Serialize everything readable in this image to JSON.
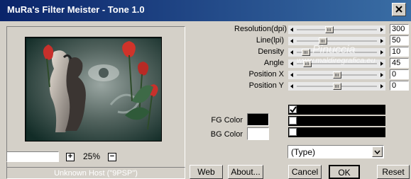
{
  "window": {
    "title": "MuRa's Filter Meister - Tone 1.0"
  },
  "sliders": [
    {
      "label": "Resolution(dpi)",
      "value": "300",
      "position": 0.4
    },
    {
      "label": "Line(lpi)",
      "value": "50",
      "position": 0.31
    },
    {
      "label": "Density",
      "value": "10",
      "position": 0.07
    },
    {
      "label": "Angle",
      "value": "45",
      "position": 0.09
    },
    {
      "label": "Position X",
      "value": "0",
      "position": 0.5
    },
    {
      "label": "Position Y",
      "value": "0",
      "position": 0.5
    }
  ],
  "colors": {
    "fg_label": "FG Color",
    "fg_value": "#000000",
    "bg_label": "BG Color",
    "bg_value": "#ffffff"
  },
  "checkboxes": [
    {
      "checked": true
    },
    {
      "checked": false
    },
    {
      "checked": false
    }
  ],
  "type_select": {
    "value": "(Type)"
  },
  "zoom": {
    "value": "25%",
    "plus": "+",
    "minus": "−"
  },
  "status": {
    "text": "Unknown Host (\"9PSP\")"
  },
  "buttons": {
    "web": "Web",
    "about": "About...",
    "cancel": "Cancel",
    "ok": "OK",
    "reset": "Reset"
  },
  "watermark": {
    "line1": "Pinuccia",
    "line2": "www.maldiregrafica.eu"
  }
}
